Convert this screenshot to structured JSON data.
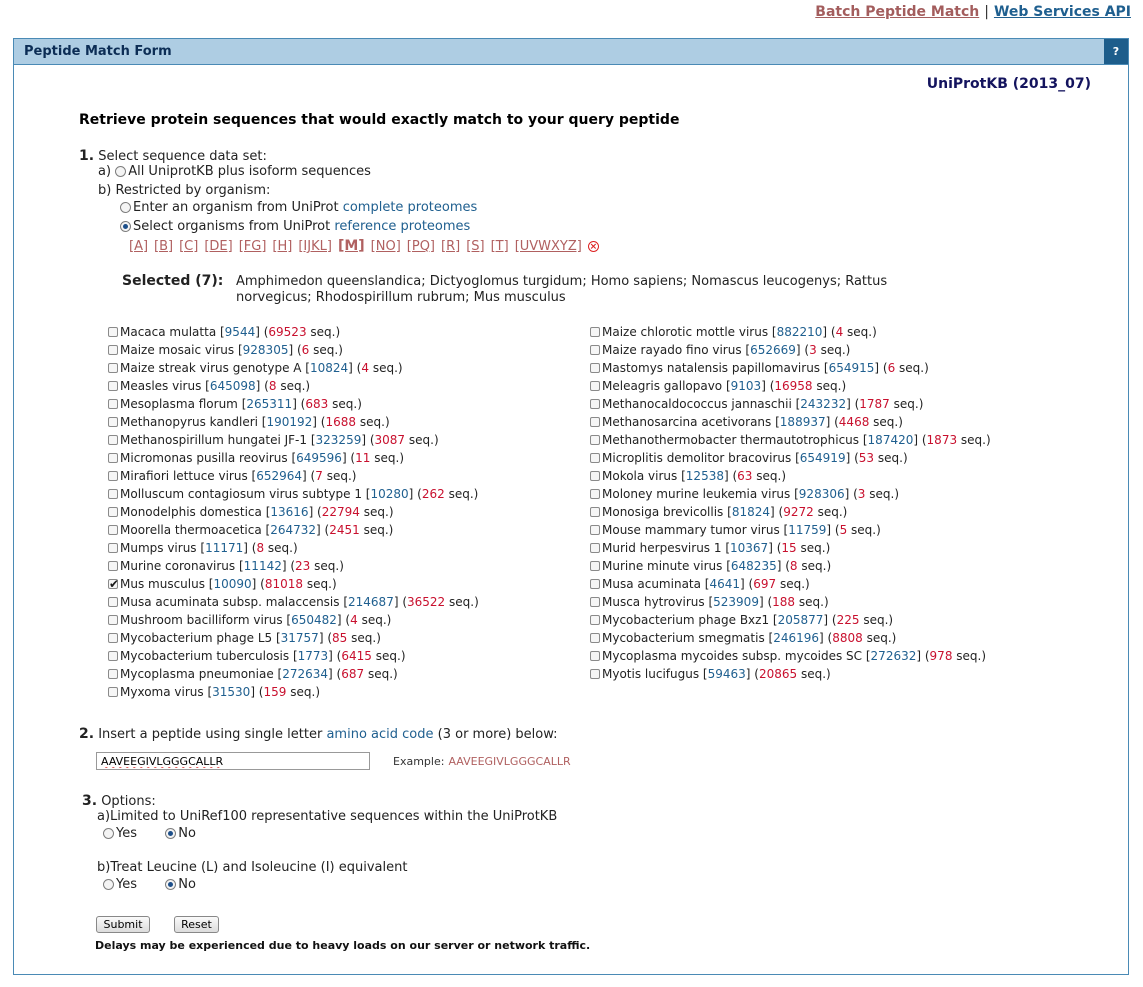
{
  "top_links": {
    "batch": "Batch Peptide Match",
    "separator": "|",
    "api": "Web Services API"
  },
  "panel": {
    "title": "Peptide Match Form",
    "help": "?"
  },
  "database_label": "UniProtKB (2013_07)",
  "heading": "Retrieve protein sequences that would exactly match to your query peptide",
  "step1": {
    "number": "1.",
    "label": "Select sequence data set:",
    "opt_a_prefix": "a)",
    "opt_a_label": "All UniprotKB plus isoform sequences",
    "opt_b_label": "b) Restricted by organism:",
    "opt_b1_text": "Enter an organism from UniProt",
    "opt_b1_link": "complete proteomes",
    "opt_b2_text": "Select organisms from UniProt",
    "opt_b2_link": "reference proteomes",
    "letters": [
      "[A]",
      "[B]",
      "[C]",
      "[DE]",
      "[FG]",
      "[H]",
      "[IJKL]",
      "[M]",
      "[NO]",
      "[PQ]",
      "[R]",
      "[S]",
      "[T]",
      "[UVWXYZ]"
    ],
    "clear_glyph": "⊗",
    "selected_label": "Selected (7):",
    "selected_list": "Amphimedon queenslandica; Dictyoglomus turgidum; Homo sapiens; Nomascus leucogenys; Rattus norvegicus; Rhodospirillum rubrum; Mus musculus"
  },
  "organisms_left": [
    {
      "name": "Macaca mulatta",
      "id": "9544",
      "count": "69523",
      "checked": false
    },
    {
      "name": "Maize mosaic virus",
      "id": "928305",
      "count": "6",
      "checked": false
    },
    {
      "name": "Maize streak virus genotype A",
      "id": "10824",
      "count": "4",
      "checked": false
    },
    {
      "name": "Measles virus",
      "id": "645098",
      "count": "8",
      "checked": false
    },
    {
      "name": "Mesoplasma florum",
      "id": "265311",
      "count": "683",
      "checked": false
    },
    {
      "name": "Methanopyrus kandleri",
      "id": "190192",
      "count": "1688",
      "checked": false
    },
    {
      "name": "Methanospirillum hungatei JF-1",
      "id": "323259",
      "count": "3087",
      "checked": false
    },
    {
      "name": "Micromonas pusilla reovirus",
      "id": "649596",
      "count": "11",
      "checked": false
    },
    {
      "name": "Mirafiori lettuce virus",
      "id": "652964",
      "count": "7",
      "checked": false
    },
    {
      "name": "Molluscum contagiosum virus subtype 1",
      "id": "10280",
      "count": "262",
      "checked": false
    },
    {
      "name": "Monodelphis domestica",
      "id": "13616",
      "count": "22794",
      "checked": false
    },
    {
      "name": "Moorella thermoacetica",
      "id": "264732",
      "count": "2451",
      "checked": false
    },
    {
      "name": "Mumps virus",
      "id": "11171",
      "count": "8",
      "checked": false
    },
    {
      "name": "Murine coronavirus",
      "id": "11142",
      "count": "23",
      "checked": false
    },
    {
      "name": "Mus musculus",
      "id": "10090",
      "count": "81018",
      "checked": true
    },
    {
      "name": "Musa acuminata subsp. malaccensis",
      "id": "214687",
      "count": "36522",
      "checked": false
    },
    {
      "name": "Mushroom bacilliform virus",
      "id": "650482",
      "count": "4",
      "checked": false
    },
    {
      "name": "Mycobacterium phage L5",
      "id": "31757",
      "count": "85",
      "checked": false
    },
    {
      "name": "Mycobacterium tuberculosis",
      "id": "1773",
      "count": "6415",
      "checked": false
    },
    {
      "name": "Mycoplasma pneumoniae",
      "id": "272634",
      "count": "687",
      "checked": false
    },
    {
      "name": "Myxoma virus",
      "id": "31530",
      "count": "159",
      "checked": false
    }
  ],
  "organisms_right": [
    {
      "name": "Maize chlorotic mottle virus",
      "id": "882210",
      "count": "4",
      "checked": false
    },
    {
      "name": "Maize rayado fino virus",
      "id": "652669",
      "count": "3",
      "checked": false
    },
    {
      "name": "Mastomys natalensis papillomavirus",
      "id": "654915",
      "count": "6",
      "checked": false
    },
    {
      "name": "Meleagris gallopavo",
      "id": "9103",
      "count": "16958",
      "checked": false
    },
    {
      "name": "Methanocaldococcus jannaschii",
      "id": "243232",
      "count": "1787",
      "checked": false
    },
    {
      "name": "Methanosarcina acetivorans",
      "id": "188937",
      "count": "4468",
      "checked": false
    },
    {
      "name": "Methanothermobacter thermautotrophicus",
      "id": "187420",
      "count": "1873",
      "checked": false
    },
    {
      "name": "Microplitis demolitor bracovirus",
      "id": "654919",
      "count": "53",
      "checked": false
    },
    {
      "name": "Mokola virus",
      "id": "12538",
      "count": "63",
      "checked": false
    },
    {
      "name": "Moloney murine leukemia virus",
      "id": "928306",
      "count": "3",
      "checked": false
    },
    {
      "name": "Monosiga brevicollis",
      "id": "81824",
      "count": "9272",
      "checked": false
    },
    {
      "name": "Mouse mammary tumor virus",
      "id": "11759",
      "count": "5",
      "checked": false
    },
    {
      "name": "Murid herpesvirus 1",
      "id": "10367",
      "count": "15",
      "checked": false
    },
    {
      "name": "Murine minute virus",
      "id": "648235",
      "count": "8",
      "checked": false
    },
    {
      "name": "Musa acuminata",
      "id": "4641",
      "count": "697",
      "checked": false
    },
    {
      "name": "Musca hytrovirus",
      "id": "523909",
      "count": "188",
      "checked": false
    },
    {
      "name": "Mycobacterium phage Bxz1",
      "id": "205877",
      "count": "225",
      "checked": false
    },
    {
      "name": "Mycobacterium smegmatis",
      "id": "246196",
      "count": "8808",
      "checked": false
    },
    {
      "name": "Mycoplasma mycoides subsp. mycoides SC",
      "id": "272632",
      "count": "978",
      "checked": false
    },
    {
      "name": "Myotis lucifugus",
      "id": "59463",
      "count": "20865",
      "checked": false
    }
  ],
  "seq_suffix": "seq.",
  "step2": {
    "number": "2.",
    "text_before": "Insert a peptide using single letter",
    "link": "amino acid code",
    "text_after": "(3 or more) below:",
    "input_value": "AAVEEGIVLGGGCALLR",
    "example_label": "Example:",
    "example_value": "AAVEEGIVLGGGCALLR"
  },
  "step3": {
    "number": "3.",
    "label": "Options:",
    "opt_a_label": "a)Limited to UniRef100 representative sequences within the UniProtKB",
    "opt_b_label": "b)Treat Leucine (L) and Isoleucine (I) equivalent",
    "yes": "Yes",
    "no": "No"
  },
  "buttons": {
    "submit": "Submit",
    "reset": "Reset"
  },
  "note": "Delays may be experienced due to heavy loads on our server or network traffic."
}
